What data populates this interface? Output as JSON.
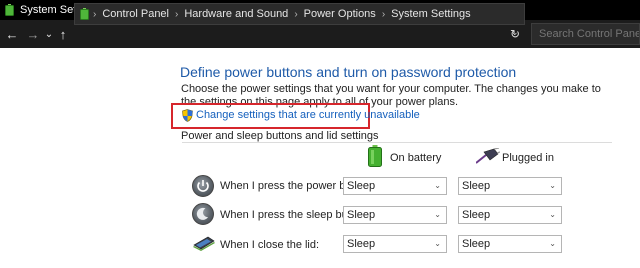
{
  "window": {
    "title": "System Settings"
  },
  "nav": {
    "back": "←",
    "forward": "→",
    "recent": "⌄",
    "up": "↑"
  },
  "address": {
    "crumbs": [
      "Control Panel",
      "Hardware and Sound",
      "Power Options",
      "System Settings"
    ],
    "separator": "›",
    "dropdown": "⌄",
    "refresh": "↻"
  },
  "search": {
    "placeholder": "Search Control Panel"
  },
  "content": {
    "heading": "Define power buttons and turn on password protection",
    "description": "Choose the power settings that you want for your computer. The changes you make to the settings on this page apply to all of your power plans.",
    "change_link": "Change settings that are currently unavailable",
    "group_label": "Power and sleep buttons and lid settings",
    "columns": [
      "On battery",
      "Plugged in"
    ],
    "rows": [
      {
        "label": "When I press the power button:",
        "on_battery": "Sleep",
        "plugged_in": "Sleep"
      },
      {
        "label": "When I press the sleep button:",
        "on_battery": "Sleep",
        "plugged_in": "Sleep"
      },
      {
        "label": "When I close the lid:",
        "on_battery": "Sleep",
        "plugged_in": "Sleep"
      }
    ]
  },
  "colors": {
    "titlebar": "#000000",
    "addressbar": "#1c1c1c",
    "heading": "#1e5aa8",
    "link": "#1560bd",
    "highlight_box": "#d6262c"
  },
  "icons": [
    "battery-icon",
    "back-arrow-icon",
    "forward-arrow-icon",
    "up-arrow-icon",
    "refresh-icon",
    "shield-icon",
    "plug-icon",
    "power-button-icon",
    "sleep-button-icon",
    "laptop-lid-icon"
  ]
}
